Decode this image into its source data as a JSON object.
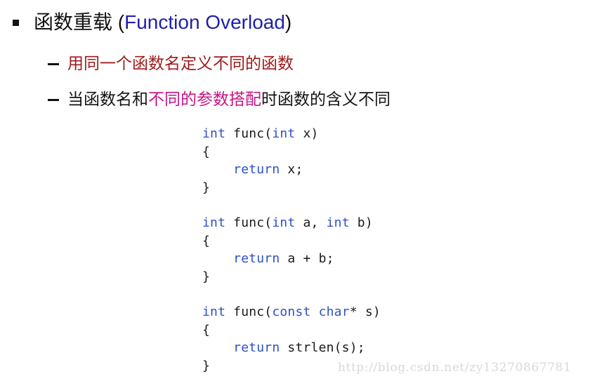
{
  "slide": {
    "background_color": "#ffffff",
    "title": {
      "bullet_icon": "square-bullet-icon",
      "cn_part": "函数重载",
      "space": " ",
      "open_paren": "(",
      "en_part": "Function Overload",
      "close_paren": ")",
      "cn_color": "#111111",
      "en_color": "#2020A8"
    },
    "bullets": [
      {
        "marker_icon": "dash-bullet-icon",
        "segments": [
          {
            "text": "用同一个函数名定义不同的函数",
            "color": "#9E1B1B"
          }
        ]
      },
      {
        "marker_icon": "dash-bullet-icon",
        "segments": [
          {
            "text": "当函数名和",
            "color": "#141414"
          },
          {
            "text": "不同的参数搭配",
            "color": "#C71585"
          },
          {
            "text": "时函数的含义不同",
            "color": "#141414"
          }
        ]
      }
    ],
    "code_blocks": [
      {
        "name": "func-int-x",
        "lines": [
          [
            {
              "t": "int",
              "k": true
            },
            {
              "t": " func(",
              "k": false
            },
            {
              "t": "int",
              "k": true
            },
            {
              "t": " x)",
              "k": false
            }
          ],
          [
            {
              "t": "{",
              "k": false
            }
          ],
          [
            {
              "t": "    ",
              "k": false
            },
            {
              "t": "return",
              "k": true
            },
            {
              "t": " x;",
              "k": false
            }
          ],
          [
            {
              "t": "}",
              "k": false
            }
          ]
        ]
      },
      {
        "name": "func-int-a-int-b",
        "lines": [
          [
            {
              "t": "int",
              "k": true
            },
            {
              "t": " func(",
              "k": false
            },
            {
              "t": "int",
              "k": true
            },
            {
              "t": " a, ",
              "k": false
            },
            {
              "t": "int",
              "k": true
            },
            {
              "t": " b)",
              "k": false
            }
          ],
          [
            {
              "t": "{",
              "k": false
            }
          ],
          [
            {
              "t": "    ",
              "k": false
            },
            {
              "t": "return",
              "k": true
            },
            {
              "t": " a + b;",
              "k": false
            }
          ],
          [
            {
              "t": "}",
              "k": false
            }
          ]
        ]
      },
      {
        "name": "func-const-char-s",
        "lines": [
          [
            {
              "t": "int",
              "k": true
            },
            {
              "t": " func(",
              "k": false
            },
            {
              "t": "const",
              "k": true
            },
            {
              "t": " ",
              "k": false
            },
            {
              "t": "char",
              "k": true
            },
            {
              "t": "* s)",
              "k": false
            }
          ],
          [
            {
              "t": "{",
              "k": false
            }
          ],
          [
            {
              "t": "    ",
              "k": false
            },
            {
              "t": "return",
              "k": true
            },
            {
              "t": " strlen(s);",
              "k": false
            }
          ],
          [
            {
              "t": "}",
              "k": false
            }
          ]
        ]
      }
    ],
    "code_keyword_color": "#2D50C8",
    "code_plain_color": "#1a1a1a",
    "watermark": "http://blog.csdn.net/zy13270867781"
  }
}
